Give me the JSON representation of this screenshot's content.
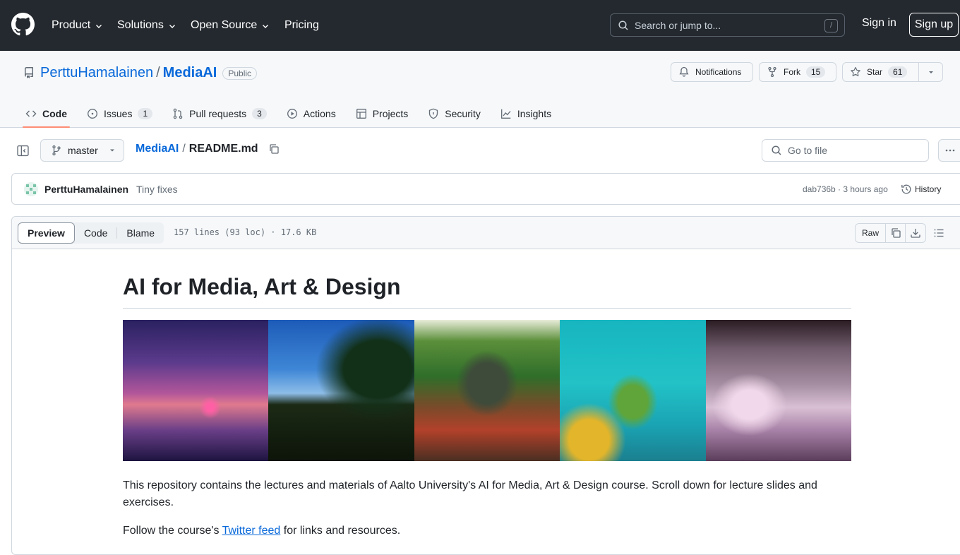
{
  "header": {
    "nav": [
      {
        "label": "Product",
        "has_menu": true
      },
      {
        "label": "Solutions",
        "has_menu": true
      },
      {
        "label": "Open Source",
        "has_menu": true
      },
      {
        "label": "Pricing",
        "has_menu": false
      }
    ],
    "search_placeholder": "Search or jump to...",
    "search_shortcut": "/",
    "signin_label": "Sign in",
    "signup_label": "Sign up"
  },
  "repo": {
    "owner": "PerttuHamalainen",
    "separator": "/",
    "name": "MediaAI",
    "visibility": "Public",
    "notifications_label": "Notifications",
    "fork_label": "Fork",
    "fork_count": "15",
    "star_label": "Star",
    "star_count": "61"
  },
  "tabs": [
    {
      "label": "Code",
      "icon": "code-icon",
      "count": null,
      "active": true
    },
    {
      "label": "Issues",
      "icon": "issue-icon",
      "count": "1",
      "active": false
    },
    {
      "label": "Pull requests",
      "icon": "pull-request-icon",
      "count": "3",
      "active": false
    },
    {
      "label": "Actions",
      "icon": "play-icon",
      "count": null,
      "active": false
    },
    {
      "label": "Projects",
      "icon": "table-icon",
      "count": null,
      "active": false
    },
    {
      "label": "Security",
      "icon": "shield-icon",
      "count": null,
      "active": false
    },
    {
      "label": "Insights",
      "icon": "graph-icon",
      "count": null,
      "active": false
    }
  ],
  "file": {
    "branch": "master",
    "path_repo": "MediaAI",
    "path_sep": "/",
    "path_file": "README.md",
    "goto_placeholder": "Go to file",
    "info": "157 lines (93 loc) · 17.6 KB",
    "views": [
      "Preview",
      "Code",
      "Blame"
    ],
    "raw_label": "Raw"
  },
  "commit": {
    "author": "PerttuHamalainen",
    "message": "Tiny fixes",
    "meta": "dab736b · 3 hours ago",
    "history_label": "History"
  },
  "readme": {
    "title": "AI for Media, Art & Design",
    "paragraph1": "This repository contains the lectures and materials of Aalto University's AI for Media, Art & Design course. Scroll down for lecture slides and exercises.",
    "p2_before": "Follow the course's ",
    "p2_link": "Twitter feed",
    "p2_after": " for links and resources."
  },
  "colors": {
    "header_bg": "#24292f",
    "link": "#0969da",
    "tab_underline": "#fd8c73",
    "border": "#d0d7de"
  }
}
